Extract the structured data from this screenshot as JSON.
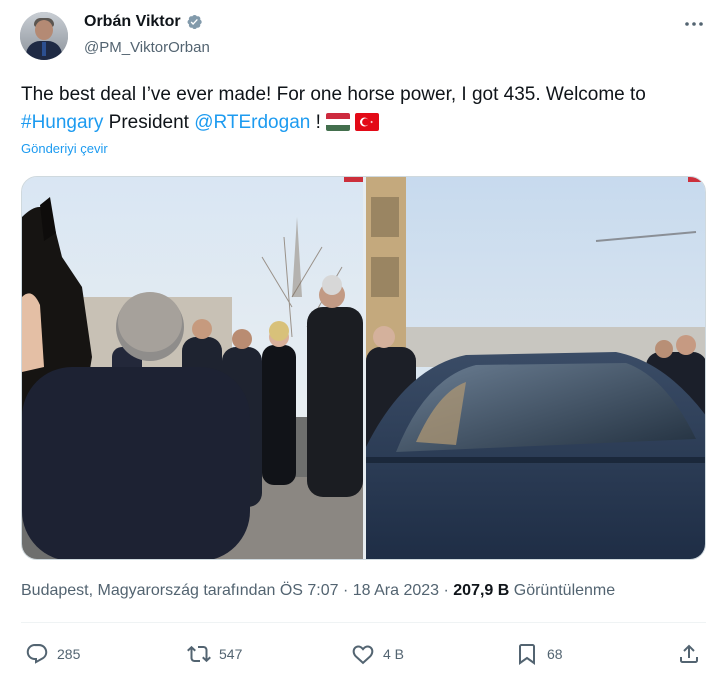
{
  "author": {
    "display_name": "Orbán Viktor",
    "handle": "@PM_ViktorOrban",
    "verified": true,
    "avatar_icon": "profile-avatar"
  },
  "tweet": {
    "line1": "The best deal I’ve ever made! For one horse power, I got 435. Welcome to",
    "hashtag": "#Hungary",
    "word_president": " President ",
    "mention": "@RTErdogan",
    "after_mention": " ! ",
    "flags": [
      "hungary-flag-icon",
      "turkey-flag-icon"
    ],
    "translate_label": "Gönderiyi çevir"
  },
  "media": {
    "photos": [
      "horse-and-erdogan-photo",
      "car-photo"
    ]
  },
  "meta": {
    "location_time": "Budapest, Magyarország tarafından ÖS 7:07 · 18 Ara 2023 · ",
    "views_count": "207,9 B",
    "views_label": " Görüntülenme"
  },
  "actions": {
    "reply_count": "285",
    "retweet_count": "547",
    "like_count": "4 B",
    "bookmark_count": "68"
  },
  "colors": {
    "accent": "#1d9bf0",
    "secondary_text": "#536471",
    "primary_text": "#0f1419"
  }
}
